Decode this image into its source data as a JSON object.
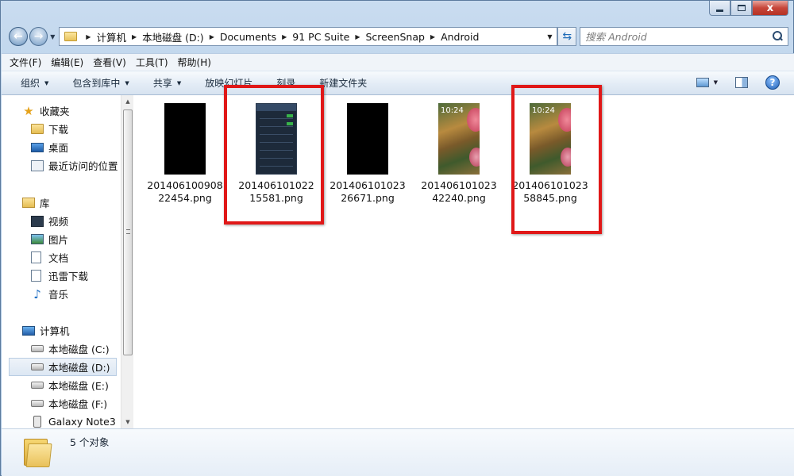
{
  "window": {
    "caption": {
      "close_glyph": "x"
    }
  },
  "address": {
    "crumbs": [
      "计算机",
      "本地磁盘 (D:)",
      "Documents",
      "91 PC Suite",
      "ScreenSnap",
      "Android"
    ],
    "search_placeholder": "搜索 Android"
  },
  "menu": [
    "文件(F)",
    "编辑(E)",
    "查看(V)",
    "工具(T)",
    "帮助(H)"
  ],
  "commands": [
    "组织",
    "包含到库中",
    "共享",
    "放映幻灯片",
    "刻录",
    "新建文件夹"
  ],
  "sidebar": {
    "favorites": {
      "label": "收藏夹",
      "items": [
        "下载",
        "桌面",
        "最近访问的位置"
      ]
    },
    "libraries": {
      "label": "库",
      "items": [
        "视频",
        "图片",
        "文档",
        "迅雷下载",
        "音乐"
      ]
    },
    "computer": {
      "label": "计算机",
      "items": [
        "本地磁盘 (C:)",
        "本地磁盘 (D:)",
        "本地磁盘 (E:)",
        "本地磁盘 (F:)",
        "Galaxy Note3"
      ],
      "selected_index": 1
    }
  },
  "files": [
    {
      "name": "20140610090822454.png",
      "thumb": "black",
      "highlighted": false
    },
    {
      "name": "20140610102215581.png",
      "thumb": "settings",
      "highlighted": true
    },
    {
      "name": "20140610102326671.png",
      "thumb": "black",
      "highlighted": false
    },
    {
      "name": "20140610102342240.png",
      "thumb": "lock",
      "highlighted": false,
      "time": "10:24"
    },
    {
      "name": "20140610102358845.png",
      "thumb": "lock",
      "highlighted": true,
      "time": "10:24"
    }
  ],
  "status": {
    "text": "5 个对象"
  },
  "colors": {
    "highlight": "#e01818",
    "accent": "#1f5fb5"
  }
}
